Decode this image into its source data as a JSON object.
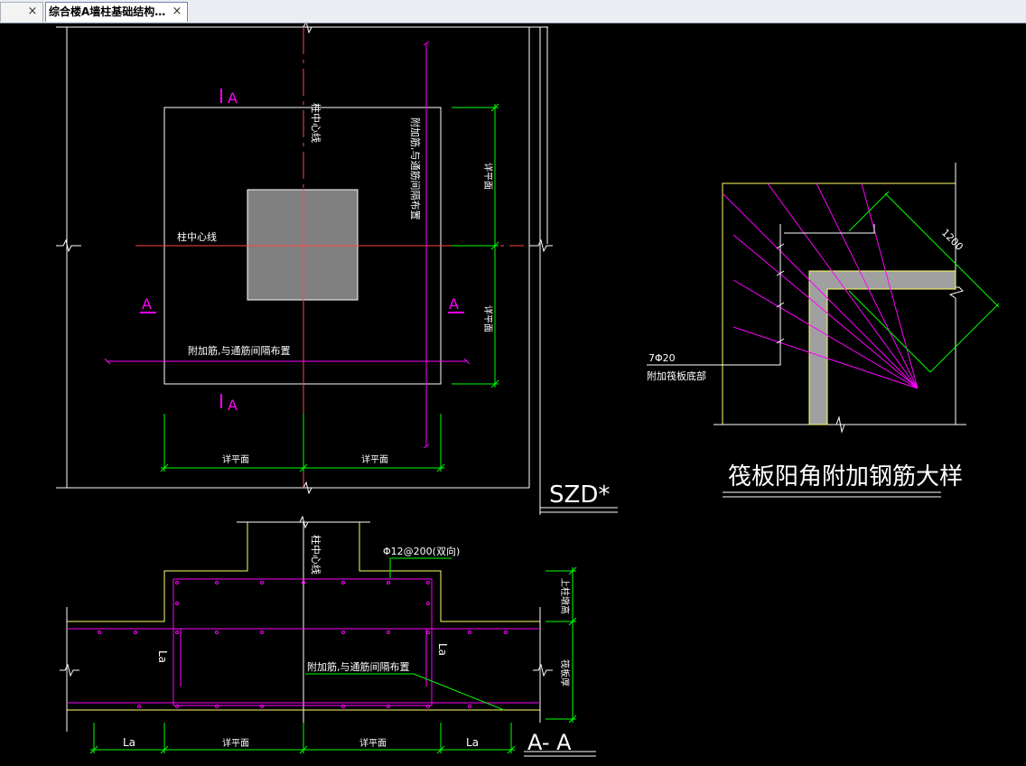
{
  "tabs": [
    {
      "label": "",
      "close": "×"
    },
    {
      "label": "综合楼A墙柱基础结构…",
      "close": "×"
    }
  ],
  "colors": {
    "background": "#000000",
    "white_line": "#ffffff",
    "green_dim": "#00ff00",
    "magenta_rebar": "#ff00ff",
    "yellow_outline": "#ffff66",
    "red_centerline": "#ff4444",
    "column_fill": "#808080"
  },
  "plan": {
    "section_mark_top": "A",
    "section_mark_bottom": "A",
    "section_mark_left": "A",
    "section_mark_right": "A",
    "col_centerline_vertical": "柱中心线",
    "col_centerline_horizontal": "柱中心线",
    "rebar_note_vertical": "附加筋,与通筋间隔布置",
    "rebar_note_horizontal": "附加筋,与通筋间隔布置",
    "dim_right_top": "详平面",
    "dim_right_bottom": "详平面",
    "dim_bottom_left": "详平面",
    "dim_bottom_right": "详平面",
    "drawing_code": "SZD*"
  },
  "section": {
    "col_centerline": "柱中心线",
    "top_rebar_note": "Φ12@200(双向)",
    "rebar_note": "附加筋,与通筋间隔布置",
    "la_left": "La",
    "la_right": "La",
    "dim_right_top": "上柱墩高",
    "dim_right_bottom": "筏板厚",
    "dim_bottom": [
      "La",
      "详平面",
      "详平面",
      "La"
    ],
    "section_title": "A- A"
  },
  "detail": {
    "dim_label": "1200",
    "rebar_count": "7Φ20",
    "rebar_note": "附加筏板底部",
    "title": "筏板阳角附加钢筋大样"
  }
}
